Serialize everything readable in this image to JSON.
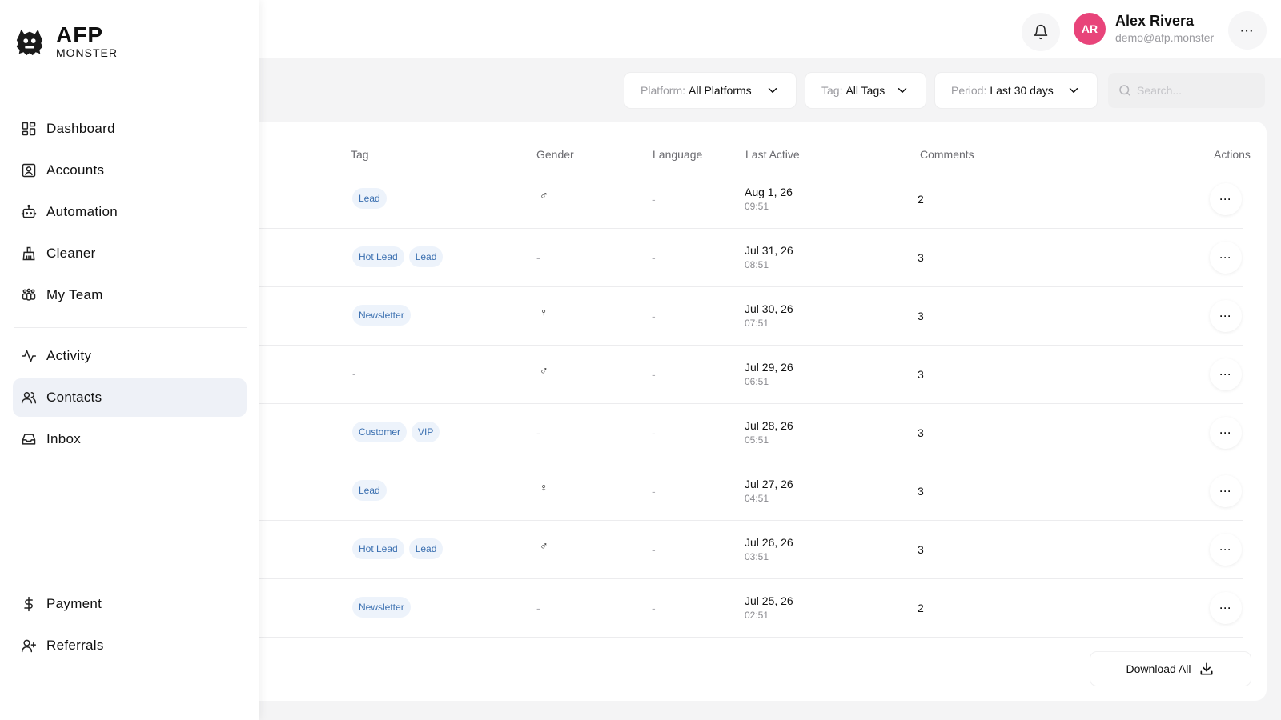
{
  "brand": {
    "name": "AFP",
    "sub": "MONSTER"
  },
  "sidebar": {
    "primary": [
      {
        "label": "Dashboard",
        "icon": "dashboard-icon"
      },
      {
        "label": "Accounts",
        "icon": "user-square-icon"
      },
      {
        "label": "Automation",
        "icon": "robot-icon"
      },
      {
        "label": "Cleaner",
        "icon": "broom-icon"
      },
      {
        "label": "My Team",
        "icon": "team-icon"
      }
    ],
    "secondary": [
      {
        "label": "Activity",
        "icon": "activity-icon"
      },
      {
        "label": "Contacts",
        "icon": "contacts-icon",
        "active": true
      },
      {
        "label": "Inbox",
        "icon": "inbox-icon"
      }
    ],
    "bottom": [
      {
        "label": "Payment",
        "icon": "dollar-icon"
      },
      {
        "label": "Referrals",
        "icon": "user-plus-icon"
      }
    ]
  },
  "header": {
    "user": {
      "initials": "AR",
      "name": "Alex Rivera",
      "email": "demo@afp.monster"
    },
    "more_label": "···"
  },
  "filters": {
    "platform": {
      "label": "Platform:",
      "value": "All Platforms"
    },
    "tag": {
      "label": "Tag:",
      "value": "All Tags"
    },
    "period": {
      "label": "Period:",
      "value": "Last 30 days"
    },
    "search_placeholder": "Search..."
  },
  "table": {
    "columns": {
      "tag": "Tag",
      "gender": "Gender",
      "language": "Language",
      "last_active": "Last Active",
      "comments": "Comments",
      "actions": "Actions"
    },
    "rows": [
      {
        "tags": [
          "Lead"
        ],
        "gender": "♂",
        "language": "-",
        "date": "Aug 1, 26",
        "time": "09:51",
        "comments": "2"
      },
      {
        "tags": [
          "Hot Lead",
          "Lead"
        ],
        "gender": "-",
        "language": "-",
        "date": "Jul 31, 26",
        "time": "08:51",
        "comments": "3"
      },
      {
        "tags": [
          "Newsletter"
        ],
        "gender": "♀",
        "language": "-",
        "date": "Jul 30, 26",
        "time": "07:51",
        "comments": "3"
      },
      {
        "tags": [],
        "gender": "♂",
        "language": "-",
        "date": "Jul 29, 26",
        "time": "06:51",
        "comments": "3"
      },
      {
        "tags": [
          "Customer",
          "VIP"
        ],
        "gender": "-",
        "language": "-",
        "date": "Jul 28, 26",
        "time": "05:51",
        "comments": "3"
      },
      {
        "tags": [
          "Lead"
        ],
        "gender": "♀",
        "language": "-",
        "date": "Jul 27, 26",
        "time": "04:51",
        "comments": "3"
      },
      {
        "tags": [
          "Hot Lead",
          "Lead"
        ],
        "gender": "♂",
        "language": "-",
        "date": "Jul 26, 26",
        "time": "03:51",
        "comments": "3"
      },
      {
        "tags": [
          "Newsletter"
        ],
        "gender": "-",
        "language": "-",
        "date": "Jul 25, 26",
        "time": "02:51",
        "comments": "2"
      }
    ],
    "empty_tag": "-",
    "row_more_label": "···"
  },
  "download_label": "Download All",
  "colors": {
    "avatar": "#e8447a",
    "tag_bg": "#edf3fb",
    "tag_text": "#3a6fb0",
    "active_nav": "#eef1f7"
  }
}
